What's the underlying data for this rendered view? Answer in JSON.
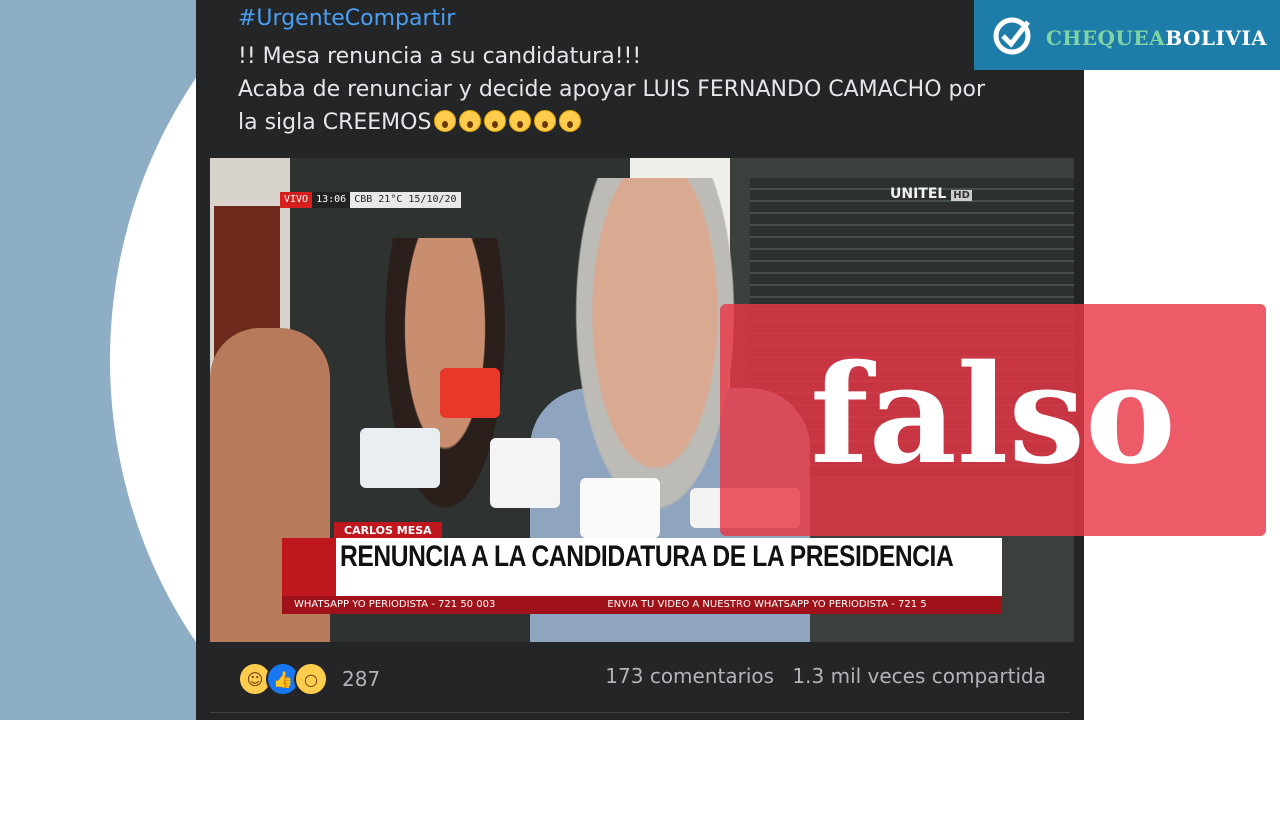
{
  "post": {
    "hashtag": "#UrgenteCompartir",
    "line1": "!! Mesa renuncia a su candidatura!!!",
    "line2": "Acaba de renunciar y decide apoyar LUIS FERNANDO CAMACHO por",
    "line3": "la sigla CREEMOS",
    "emoji_icon": "astonished-face-icon",
    "emoji_count": 6
  },
  "video": {
    "live_badge": "VIVO",
    "time": "13:06",
    "location": "CBB 21°C 15/10/20",
    "channel": "UNITEL",
    "channel_suffix": "HD",
    "speaker_name": "CARLOS MESA",
    "headline": "RENUNCIA A LA CANDIDATURA DE LA PRESIDENCIA",
    "ticker_left": "WHATSAPP YO PERIODISTA - 721 50 003",
    "ticker_right": "ENVIA TU VIDEO A NUESTRO WHATSAPP YO PERIODISTA - 721 5"
  },
  "stats": {
    "reaction_icons": [
      "haha-icon",
      "like-icon",
      "wow-icon"
    ],
    "reaction_count": "287",
    "comments": "173 comentarios",
    "shares": "1.3 mil veces compartida"
  },
  "logo": {
    "part1": "CHEQUEA",
    "part2": "BOLIVIA"
  },
  "verdict": {
    "label": "falso",
    "color": "#e83746"
  }
}
